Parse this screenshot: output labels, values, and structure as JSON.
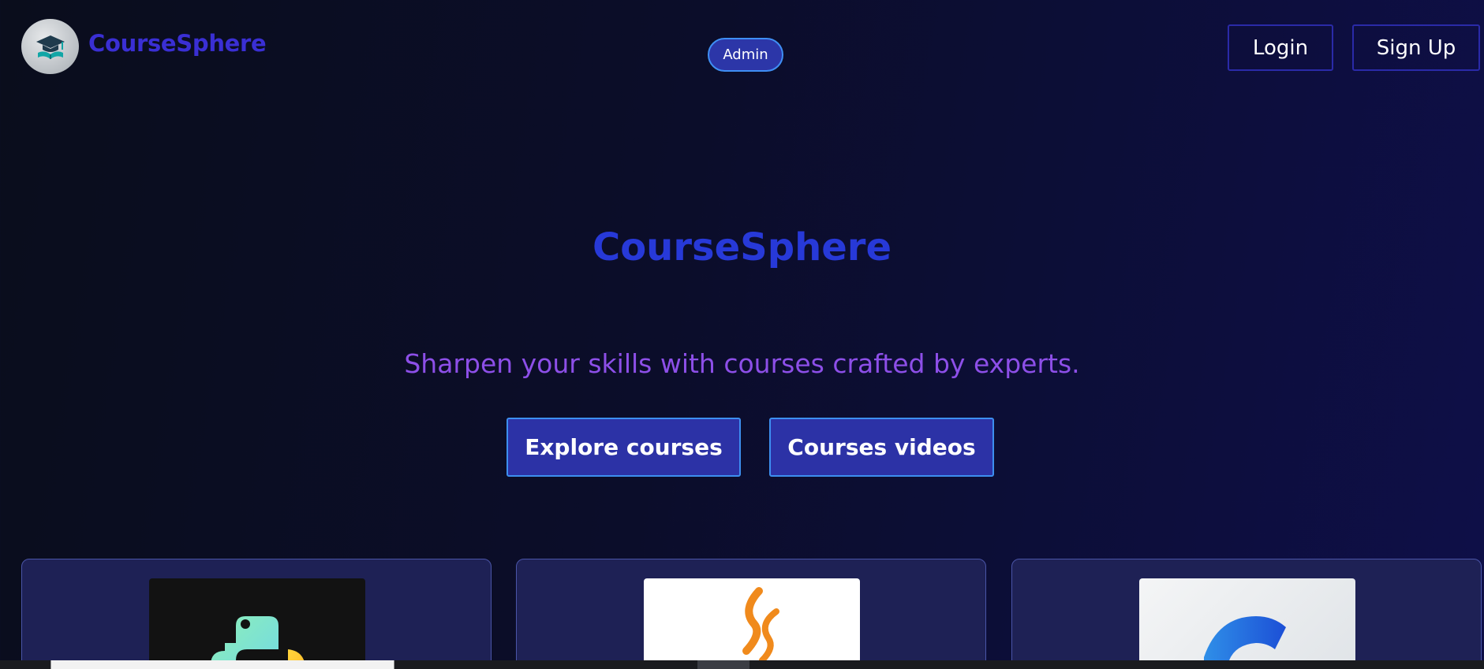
{
  "header": {
    "brand": "CourseSphere",
    "admin_label": "Admin",
    "login_label": "Login",
    "signup_label": "Sign Up"
  },
  "hero": {
    "title": "CourseSphere",
    "tagline": "Sharpen your skills with courses crafted by experts.",
    "explore_label": "Explore courses",
    "videos_label": "Courses videos"
  },
  "courses": [
    {
      "icon": "python-logo-icon"
    },
    {
      "icon": "java-logo-icon"
    },
    {
      "icon": "c-language-logo-icon"
    }
  ],
  "colors": {
    "brand_text": "#3a2fd4",
    "hero_title": "#2739d8",
    "tagline": "#8d4fe8",
    "button_fill": "#2c32a6",
    "button_border": "#3d8ff0",
    "card_fill": "#1e2155"
  }
}
